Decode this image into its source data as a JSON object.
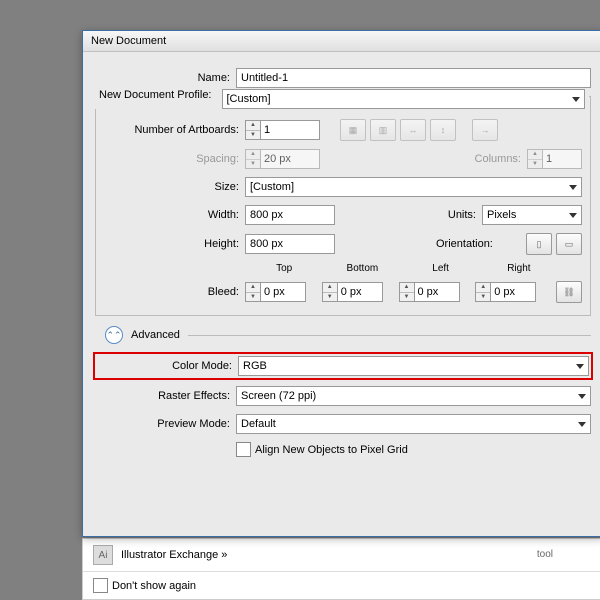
{
  "window": {
    "title": "New Document"
  },
  "fields": {
    "name_label": "Name:",
    "name_value": "Untitled-1",
    "profile_label": "New Document Profile:",
    "profile_value": "[Custom]",
    "artboards_label": "Number of Artboards:",
    "artboards_value": "1",
    "spacing_label": "Spacing:",
    "spacing_value": "20 px",
    "columns_label": "Columns:",
    "columns_value": "1",
    "size_label": "Size:",
    "size_value": "[Custom]",
    "width_label": "Width:",
    "width_value": "800 px",
    "units_label": "Units:",
    "units_value": "Pixels",
    "height_label": "Height:",
    "height_value": "800 px",
    "orientation_label": "Orientation:",
    "bleed_label": "Bleed:",
    "bleed_top": "Top",
    "bleed_bottom": "Bottom",
    "bleed_left": "Left",
    "bleed_right": "Right",
    "bleed_value": "0 px"
  },
  "advanced": {
    "label": "Advanced",
    "color_mode_label": "Color Mode:",
    "color_mode_value": "RGB",
    "raster_label": "Raster Effects:",
    "raster_value": "Screen (72 ppi)",
    "preview_label": "Preview Mode:",
    "preview_value": "Default",
    "align_label": "Align New Objects to Pixel Grid"
  },
  "background": {
    "exchange": "Illustrator Exchange »",
    "dontshow": "Don't show again",
    "tool": "tool"
  }
}
